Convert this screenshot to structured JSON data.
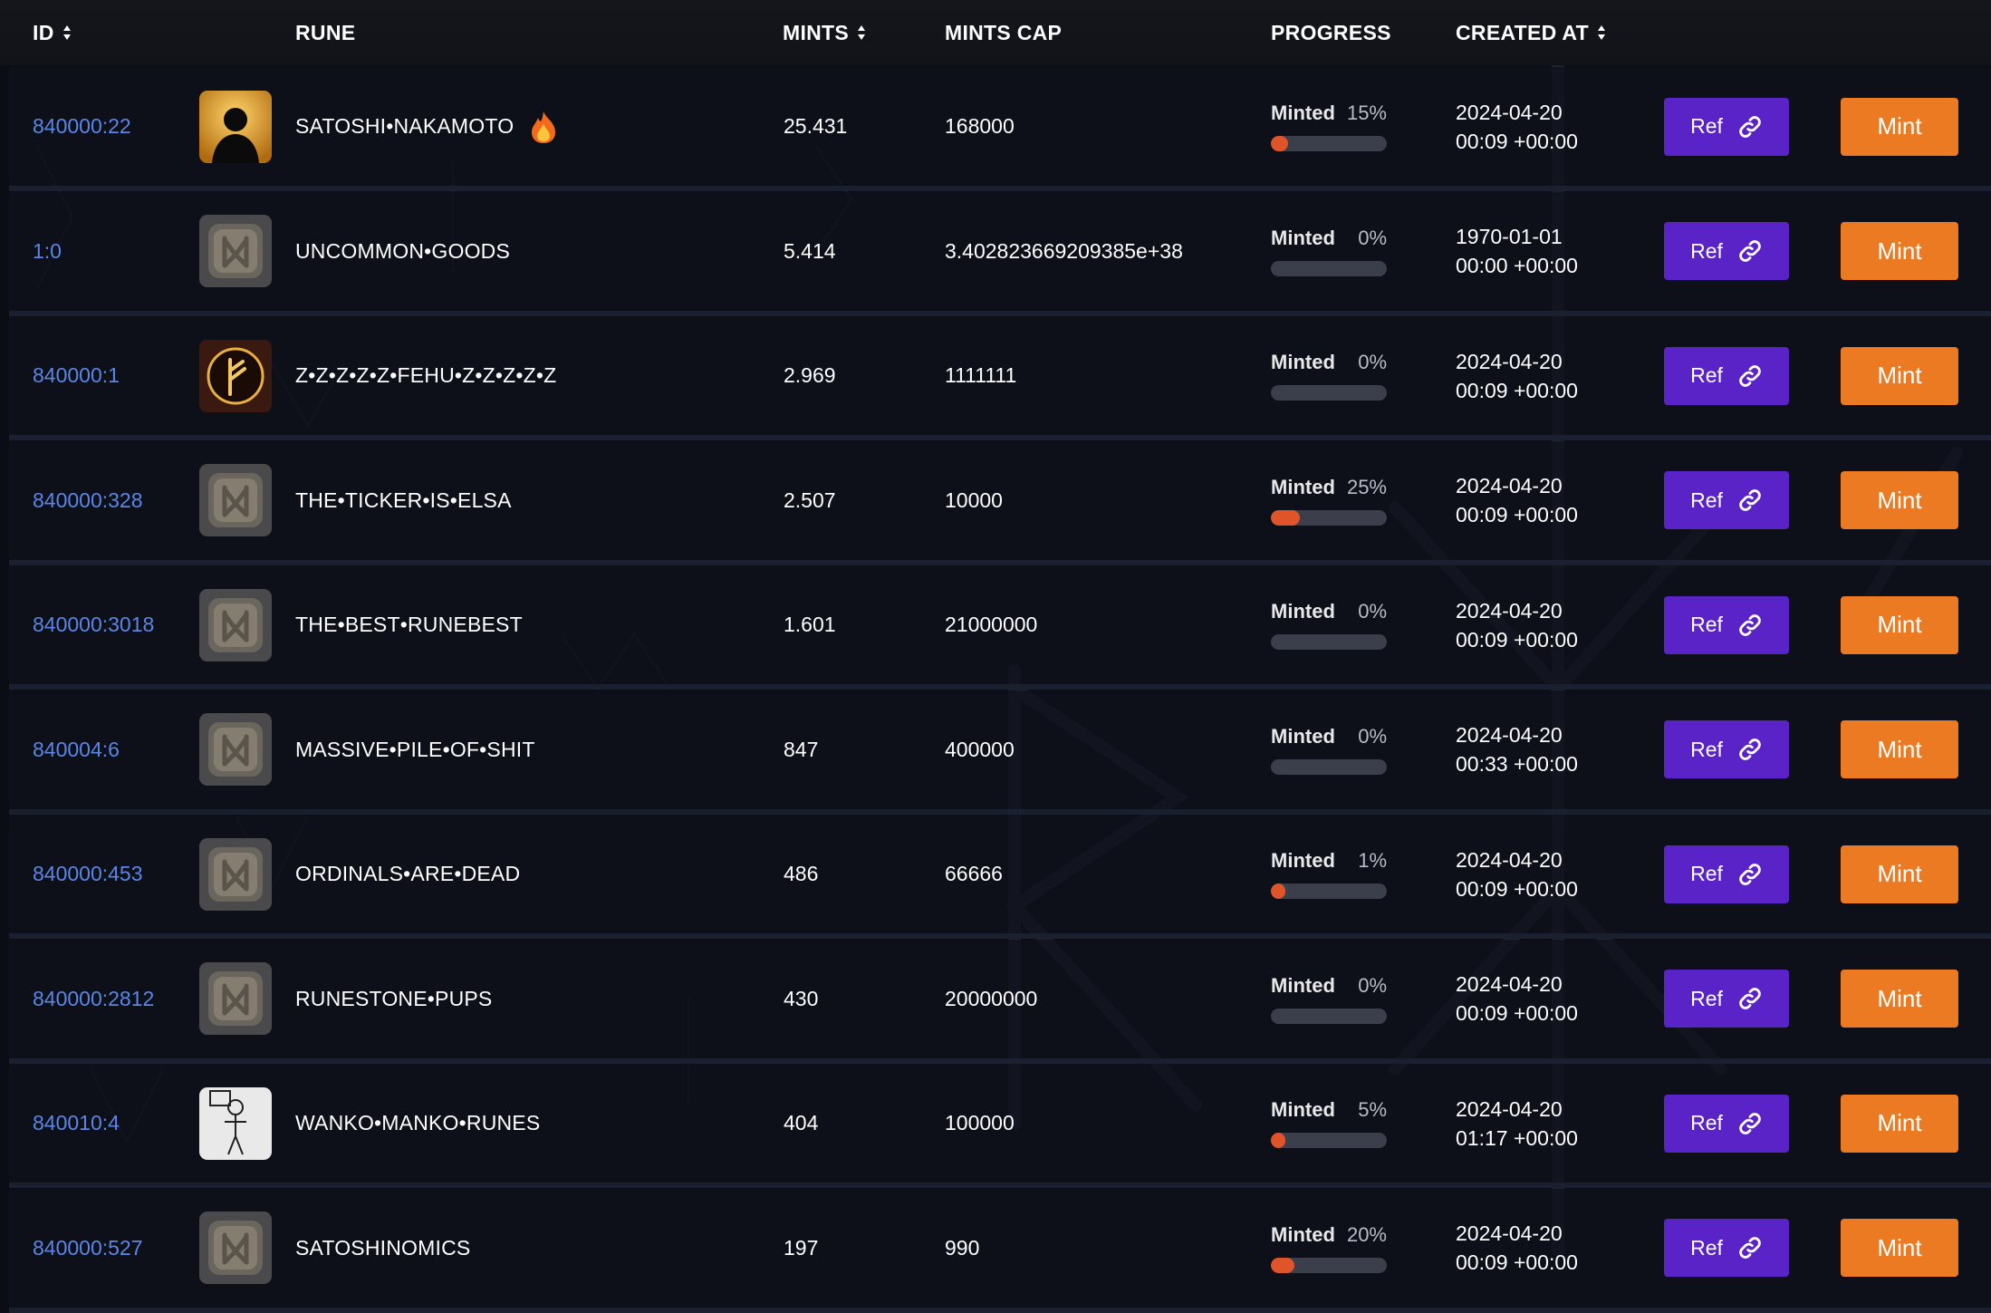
{
  "colors": {
    "background": "#0b0d14",
    "id_link": "#5b86e5",
    "ref_button": "#5a23c8",
    "mint_button": "#ec7a22",
    "progress_fill": "#e0542a",
    "progress_track": "#3a3f4b"
  },
  "header": {
    "id": "ID",
    "rune": "RUNE",
    "mints": "MINTS",
    "mints_cap": "MINTS CAP",
    "progress": "PROGRESS",
    "created_at": "CREATED AT"
  },
  "rows": [
    {
      "id": "840000:22",
      "rune": "SATOSHI•NAKAMOTO",
      "icon": "silhouette-avatar",
      "hot": true,
      "mints": "25.431",
      "cap": "168000",
      "progress_label": "Minted",
      "progress_pct": "15%",
      "progress": 0.15,
      "date": "2024-04-20",
      "time": "00:09 +00:00",
      "ref_label": "Ref",
      "mint_label": "Mint"
    },
    {
      "id": "1:0",
      "rune": "UNCOMMON•GOODS",
      "icon": "rune-stone",
      "hot": false,
      "mints": "5.414",
      "cap": "3.402823669209385e+38",
      "progress_label": "Minted",
      "progress_pct": "0%",
      "progress": 0,
      "date": "1970-01-01",
      "time": "00:00 +00:00",
      "ref_label": "Ref",
      "mint_label": "Mint"
    },
    {
      "id": "840000:1",
      "rune": "Z•Z•Z•Z•Z•FEHU•Z•Z•Z•Z•Z",
      "icon": "fehu-rune",
      "hot": false,
      "mints": "2.969",
      "cap": "1111111",
      "progress_label": "Minted",
      "progress_pct": "0%",
      "progress": 0,
      "date": "2024-04-20",
      "time": "00:09 +00:00",
      "ref_label": "Ref",
      "mint_label": "Mint"
    },
    {
      "id": "840000:328",
      "rune": "THE•TICKER•IS•ELSA",
      "icon": "rune-stone",
      "hot": false,
      "mints": "2.507",
      "cap": "10000",
      "progress_label": "Minted",
      "progress_pct": "25%",
      "progress": 0.25,
      "date": "2024-04-20",
      "time": "00:09 +00:00",
      "ref_label": "Ref",
      "mint_label": "Mint"
    },
    {
      "id": "840000:3018",
      "rune": "THE•BEST•RUNEBEST",
      "icon": "rune-stone",
      "hot": false,
      "mints": "1.601",
      "cap": "21000000",
      "progress_label": "Minted",
      "progress_pct": "0%",
      "progress": 0,
      "date": "2024-04-20",
      "time": "00:09 +00:00",
      "ref_label": "Ref",
      "mint_label": "Mint"
    },
    {
      "id": "840004:6",
      "rune": "MASSIVE•PILE•OF•SHIT",
      "icon": "rune-stone",
      "hot": false,
      "mints": "847",
      "cap": "400000",
      "progress_label": "Minted",
      "progress_pct": "0%",
      "progress": 0,
      "date": "2024-04-20",
      "time": "00:33 +00:00",
      "ref_label": "Ref",
      "mint_label": "Mint"
    },
    {
      "id": "840000:453",
      "rune": "ORDINALS•ARE•DEAD",
      "icon": "rune-stone",
      "hot": false,
      "mints": "486",
      "cap": "66666",
      "progress_label": "Minted",
      "progress_pct": "1%",
      "progress": 0.01,
      "date": "2024-04-20",
      "time": "00:09 +00:00",
      "ref_label": "Ref",
      "mint_label": "Mint"
    },
    {
      "id": "840000:2812",
      "rune": "RUNESTONE•PUPS",
      "icon": "rune-stone",
      "hot": false,
      "mints": "430",
      "cap": "20000000",
      "progress_label": "Minted",
      "progress_pct": "0%",
      "progress": 0,
      "date": "2024-04-20",
      "time": "00:09 +00:00",
      "ref_label": "Ref",
      "mint_label": "Mint"
    },
    {
      "id": "840010:4",
      "rune": "WANKO•MANKO•RUNES",
      "icon": "sketch-figure",
      "hot": false,
      "mints": "404",
      "cap": "100000",
      "progress_label": "Minted",
      "progress_pct": "5%",
      "progress": 0.05,
      "date": "2024-04-20",
      "time": "01:17 +00:00",
      "ref_label": "Ref",
      "mint_label": "Mint"
    },
    {
      "id": "840000:527",
      "rune": "SATOSHINOMICS",
      "icon": "rune-stone",
      "hot": false,
      "mints": "197",
      "cap": "990",
      "progress_label": "Minted",
      "progress_pct": "20%",
      "progress": 0.2,
      "date": "2024-04-20",
      "time": "00:09 +00:00",
      "ref_label": "Ref",
      "mint_label": "Mint"
    }
  ]
}
